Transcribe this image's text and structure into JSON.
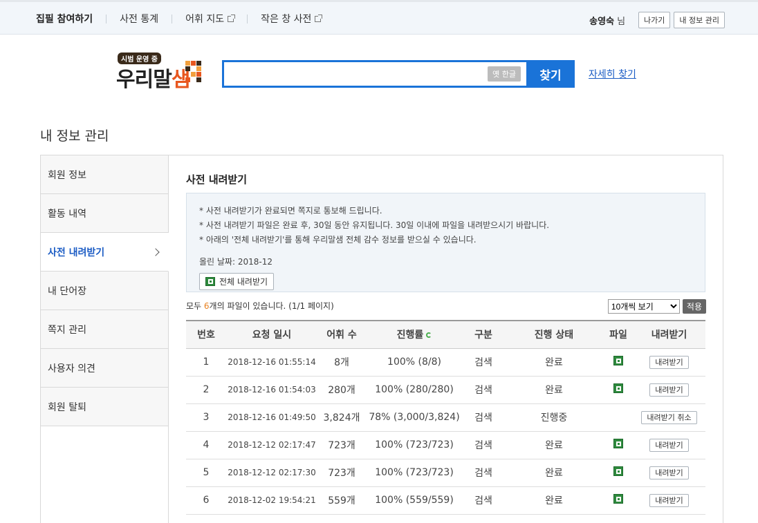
{
  "topnav": {
    "items": [
      {
        "label": "집필 참여하기",
        "external": false
      },
      {
        "label": "사전 통계",
        "external": false
      },
      {
        "label": "어휘 지도",
        "external": true
      },
      {
        "label": "작은 창 사전",
        "external": true
      }
    ],
    "user_name": "송영숙",
    "user_suffix": "님",
    "logout": "나가기",
    "my_info": "내 정보 관리"
  },
  "header": {
    "logo_badge": "시범 운영 중",
    "logo_text": "우리말",
    "logo_sam": "샘",
    "search_value": "",
    "old_hangul": "옛 한글",
    "search_button": "찾기",
    "advanced": "자세히 찾기"
  },
  "page_title": "내 정보 관리",
  "sidebar": {
    "items": [
      {
        "label": "회원 정보",
        "active": false
      },
      {
        "label": "활동 내역",
        "active": false
      },
      {
        "label": "사전 내려받기",
        "active": true
      },
      {
        "label": "내 단어장",
        "active": false
      },
      {
        "label": "쪽지 관리",
        "active": false
      },
      {
        "label": "사용자 의견",
        "active": false
      },
      {
        "label": "회원 탈퇴",
        "active": false
      }
    ]
  },
  "main": {
    "title": "사전 내려받기",
    "notice": [
      "* 사전 내려받기가 완료되면 쪽지로 통보해 드립니다.",
      "* 사전 내려받기 파일은 완료 후, 30일 동안 유지됩니다. 30일 이내에 파일을 내려받으시기 바랍니다.",
      "* 아래의 '전체 내려받기'를 통해 우리말샘 전체 감수 정보를 받으실 수 있습니다."
    ],
    "upload_date": "올린 날짜: 2018-12",
    "download_all": "전체 내려받기",
    "summary_prefix": "모두 ",
    "summary_count": "6",
    "summary_suffix": "개의 파일이 있습니다. (1/1 페이지)",
    "page_size": "10개씩 보기",
    "apply": "적용",
    "columns": [
      "번호",
      "요청 일시",
      "어휘 수",
      "진행률",
      "구분",
      "진행 상태",
      "파일",
      "내려받기"
    ],
    "rows": [
      {
        "no": "1",
        "date": "2018-12-16 01:55:14",
        "count": "8개",
        "progress": "100% (8/8)",
        "type": "검색",
        "status": "완료",
        "file": true,
        "action": "내려받기"
      },
      {
        "no": "2",
        "date": "2018-12-16 01:54:03",
        "count": "280개",
        "progress": "100% (280/280)",
        "type": "검색",
        "status": "완료",
        "file": true,
        "action": "내려받기"
      },
      {
        "no": "3",
        "date": "2018-12-16 01:49:50",
        "count": "3,824개",
        "progress": "78% (3,000/3,824)",
        "type": "검색",
        "status": "진행중",
        "file": false,
        "action": "내려받기 취소"
      },
      {
        "no": "4",
        "date": "2018-12-12 02:17:47",
        "count": "723개",
        "progress": "100% (723/723)",
        "type": "검색",
        "status": "완료",
        "file": true,
        "action": "내려받기"
      },
      {
        "no": "5",
        "date": "2018-12-12 02:17:30",
        "count": "723개",
        "progress": "100% (723/723)",
        "type": "검색",
        "status": "완료",
        "file": true,
        "action": "내려받기"
      },
      {
        "no": "6",
        "date": "2018-12-02 19:54:21",
        "count": "559개",
        "progress": "100% (559/559)",
        "type": "검색",
        "status": "완료",
        "file": true,
        "action": "내려받기"
      }
    ]
  },
  "colors": {
    "accent": "#1a73d8",
    "link": "#1a5bc4",
    "highlight": "#e8811f",
    "logo_orange": "#e8571f"
  },
  "icons": [
    "external-link-icon",
    "excel-icon",
    "chevron-right-icon",
    "refresh-icon"
  ]
}
